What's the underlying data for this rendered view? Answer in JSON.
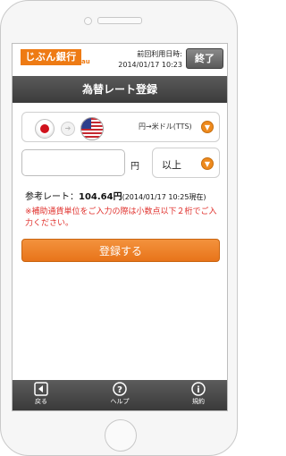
{
  "header": {
    "logo_text": "じぶん銀行",
    "logo_sub": "au",
    "last_use_label": "前回利用日時:",
    "last_use_time": "2014/01/17 10:23",
    "end_button": "終了"
  },
  "title": "為替レート登録",
  "currency": {
    "pair_label": "円→米ドル(TTS)",
    "from_flag": "japan-flag",
    "to_flag": "usa-flag"
  },
  "amount": {
    "value": "",
    "placeholder": "",
    "unit": "円"
  },
  "condition": {
    "selected": "以上"
  },
  "rate": {
    "label": "参考レート：",
    "value": "104.64円",
    "timestamp": "(2014/01/17 10:25現在)"
  },
  "note": "※補助通貨単位をご入力の際は小数点以下２桁でご入力ください。",
  "register_button": "登録する",
  "toolbar": {
    "back": "戻る",
    "help": "ヘルプ",
    "terms": "規約"
  },
  "colors": {
    "accent": "#ee7b14",
    "header_bar": "#4a4a4a",
    "warning": "#e0302c"
  }
}
